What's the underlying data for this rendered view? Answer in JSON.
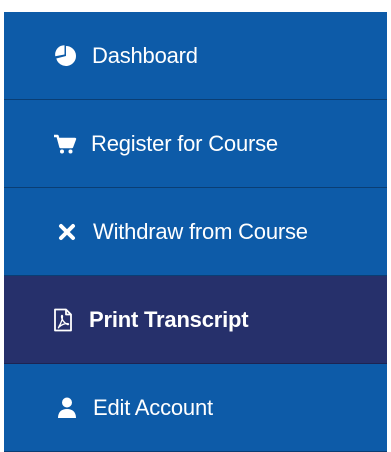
{
  "sidebar": {
    "items": [
      {
        "label": "Dashboard",
        "icon": "pie-chart-icon",
        "active": false
      },
      {
        "label": "Register for Course",
        "icon": "shopping-cart-icon",
        "active": false
      },
      {
        "label": "Withdraw from Course",
        "icon": "close-icon",
        "active": false
      },
      {
        "label": "Print Transcript",
        "icon": "pdf-file-icon",
        "active": true
      },
      {
        "label": "Edit Account",
        "icon": "user-icon",
        "active": false
      }
    ]
  },
  "colors": {
    "item_background": "#0d5ba8",
    "active_background": "#26306b",
    "text": "#ffffff"
  }
}
